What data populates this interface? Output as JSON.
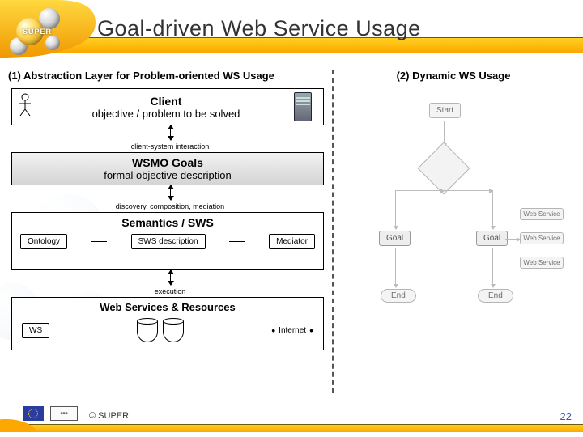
{
  "header": {
    "title": "Goal-driven Web Service Usage",
    "logo_text": "SUPER"
  },
  "left": {
    "title": "(1) Abstraction Layer for Problem-oriented WS Usage",
    "client": {
      "title": "Client",
      "subtitle": "objective / problem to be solved"
    },
    "arrow1_label": "client-system interaction",
    "goals": {
      "title": "WSMO Goals",
      "subtitle": "formal objective description"
    },
    "arrow2_label": "discovery, composition, mediation",
    "sws": {
      "title": "Semantics / SWS",
      "ontology": "Ontology",
      "sws_desc": "SWS description",
      "mediator": "Mediator"
    },
    "arrow3_label": "execution",
    "wsr": {
      "title": "Web Services & Resources",
      "ws": "WS",
      "internet": "Internet"
    }
  },
  "right": {
    "title": "(2) Dynamic WS Usage",
    "start": "Start",
    "goal": "Goal",
    "web_service": "Web Service",
    "end": "End"
  },
  "footer": {
    "copyright": "© SUPER",
    "page": "22",
    "tiny_logo": "■■■"
  }
}
